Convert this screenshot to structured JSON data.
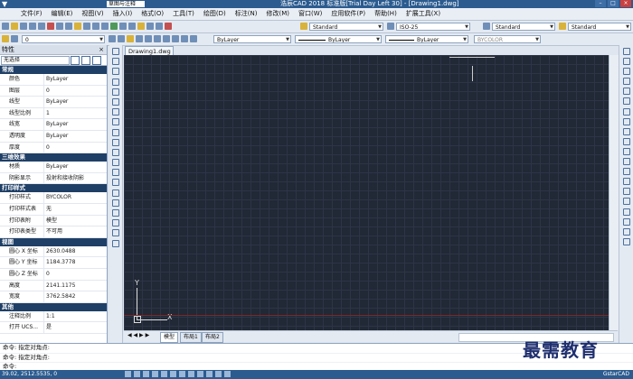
{
  "titlebar": {
    "workspace": "草图与注释",
    "title": "浩辰CAD 2018 标准版[Trial Day Left 30] - [Drawing1.dwg]"
  },
  "menu": [
    "文件(F)",
    "编辑(E)",
    "视图(V)",
    "插入(I)",
    "格式(O)",
    "工具(T)",
    "绘图(D)",
    "标注(N)",
    "修改(M)",
    "窗口(W)",
    "应用软件(P)",
    "帮助(H)",
    "扩展工具(X)"
  ],
  "toolbar1": {
    "text_style": "Standard",
    "dim_style": "ISO-25",
    "table_style": "Standard",
    "mleader_style": "Standard"
  },
  "toolbar2": {
    "layer": "0",
    "color": "ByLayer",
    "linetype": "ByLayer",
    "lineweight": "ByLayer",
    "plotstyle": "BYCOLOR"
  },
  "properties": {
    "title": "特性",
    "selection": "无选择",
    "sections": [
      {
        "name": "常规",
        "rows": [
          [
            "颜色",
            "ByLayer"
          ],
          [
            "图层",
            "0"
          ],
          [
            "线型",
            "ByLayer"
          ],
          [
            "线型比例",
            "1"
          ],
          [
            "线宽",
            "ByLayer"
          ],
          [
            "透明度",
            "ByLayer"
          ],
          [
            "厚度",
            "0"
          ]
        ]
      },
      {
        "name": "三维效果",
        "rows": [
          [
            "材质",
            "ByLayer"
          ],
          [
            "阴影显示",
            "投射和接收阴影"
          ]
        ]
      },
      {
        "name": "打印样式",
        "rows": [
          [
            "打印样式",
            "BYCOLOR"
          ],
          [
            "打印样式表",
            "无"
          ],
          [
            "打印表附",
            "模型"
          ],
          [
            "打印表类型",
            "不可用"
          ]
        ]
      },
      {
        "name": "视图",
        "rows": [
          [
            "圆心 X 坐标",
            "2630.0488"
          ],
          [
            "圆心 Y 坐标",
            "1184.3778"
          ],
          [
            "圆心 Z 坐标",
            "0"
          ],
          [
            "高度",
            "2141.1175"
          ],
          [
            "宽度",
            "3762.5842"
          ]
        ]
      },
      {
        "name": "其他",
        "rows": [
          [
            "注释比例",
            "1:1"
          ],
          [
            "打开 UCS...",
            "是"
          ]
        ]
      }
    ]
  },
  "document": {
    "tab": "Drawing1.dwg"
  },
  "layout_tabs": [
    "模型",
    "布局1",
    "布局2"
  ],
  "ucs": {
    "y": "Y",
    "x": "X"
  },
  "command": {
    "lines": [
      "命令: 指定对角点:",
      "命令: 指定对角点:",
      "命令:"
    ]
  },
  "status": {
    "coords": "39.02, 2512.5535, 0",
    "right": "GstarCAD"
  },
  "watermark": "最需教育"
}
